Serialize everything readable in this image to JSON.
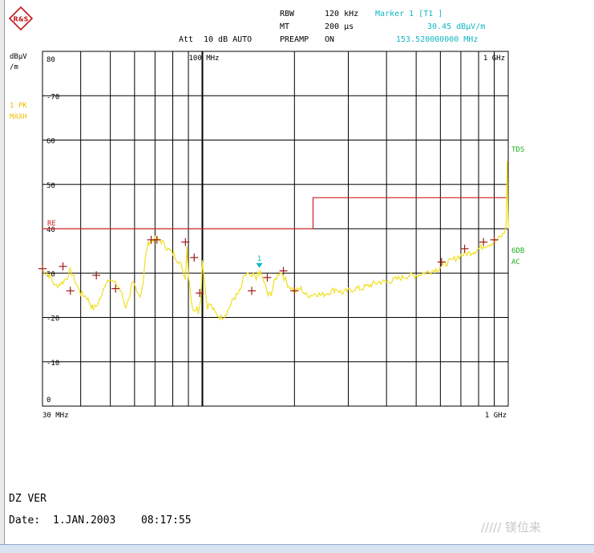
{
  "header": {
    "rbw_label": "RBW",
    "rbw_value": "120 kHz",
    "mt_label": "MT",
    "mt_value": "200 µs",
    "att_label": "Att",
    "att_value": "10 dB AUTO",
    "preamp_label": "PREAMP",
    "preamp_value": "ON",
    "marker_label": "Marker 1 [T1 ]",
    "marker_level": "30.45 dBµV/m",
    "marker_freq": "153.520000000 MHz"
  },
  "logo": {
    "text": "R&S",
    "icon": "rohde-schwarz-logo-icon"
  },
  "footer": {
    "title": "DZ VER",
    "date_label": "Date:",
    "date_value": "1.JAN.2003",
    "time_value": "08:17:55"
  },
  "watermark": "///// 镁位来",
  "colors": {
    "trace": "#f0e020",
    "limit": "#d02020",
    "marker": "#a01818",
    "marker_current": "#13b6c2",
    "side_label_green": "#20b020",
    "side_label_yellow": "#f0c000",
    "grid": "#000000"
  },
  "chart_data": {
    "type": "line",
    "x_scale": "log",
    "xlim_mhz": [
      30,
      1000
    ],
    "ylim": [
      0,
      80
    ],
    "ylabel": "dBµV\n/m",
    "grid": true,
    "y_ticks": [
      0,
      10,
      20,
      30,
      40,
      50,
      60,
      70,
      80
    ],
    "y_tick_labels": [
      "0",
      "-10",
      "-20",
      "30",
      "40",
      "50",
      "60",
      "-70",
      "80"
    ],
    "x_tick_labels_top": [
      {
        "mhz": 100,
        "label": "100 MHz"
      },
      {
        "mhz": 1000,
        "label": "1 GHz"
      }
    ],
    "x_tick_labels_bottom": [
      {
        "mhz": 30,
        "label": "30 MHz"
      },
      {
        "mhz": 1000,
        "label": "1 GHz"
      }
    ],
    "side_labels_left": [
      {
        "text": "1 PK",
        "color": "yellow"
      },
      {
        "text": "MAXH",
        "color": "yellow"
      }
    ],
    "side_labels_right": [
      {
        "text": "TDS",
        "color": "green"
      },
      {
        "text": "6DB",
        "color": "green"
      },
      {
        "text": "AC",
        "color": "green"
      }
    ],
    "limit_line": {
      "name": "RE",
      "points_mhz_db": [
        [
          30,
          40
        ],
        [
          230,
          40
        ],
        [
          230,
          47
        ],
        [
          1000,
          47
        ]
      ]
    },
    "series": [
      {
        "points_mhz_db": [
          [
            30,
            30.5
          ],
          [
            31,
            30
          ],
          [
            32,
            29
          ],
          [
            33,
            27
          ],
          [
            34,
            27.5
          ],
          [
            35,
            28
          ],
          [
            36,
            29
          ],
          [
            37,
            30.5
          ],
          [
            38,
            29
          ],
          [
            39,
            27
          ],
          [
            40,
            25.5
          ],
          [
            41,
            25
          ],
          [
            42,
            24.5
          ],
          [
            43,
            23
          ],
          [
            44,
            22
          ],
          [
            45,
            22.5
          ],
          [
            46,
            24
          ],
          [
            47,
            25
          ],
          [
            48,
            27.5
          ],
          [
            49,
            28.5
          ],
          [
            50,
            29
          ],
          [
            51,
            28
          ],
          [
            52,
            27.5
          ],
          [
            53,
            27
          ],
          [
            54,
            26
          ],
          [
            55,
            24.5
          ],
          [
            56,
            22.5
          ],
          [
            57,
            23.5
          ],
          [
            58,
            25.5
          ],
          [
            59,
            27.5
          ],
          [
            60,
            27
          ],
          [
            61,
            25.5
          ],
          [
            62,
            25
          ],
          [
            63,
            25.5
          ],
          [
            64,
            28
          ],
          [
            65,
            33
          ],
          [
            66,
            36
          ],
          [
            67,
            37
          ],
          [
            68,
            37.5
          ],
          [
            70,
            37.5
          ],
          [
            72,
            37.5
          ],
          [
            74,
            37
          ],
          [
            76,
            36
          ],
          [
            78,
            35
          ],
          [
            80,
            34.5
          ],
          [
            82,
            33.5
          ],
          [
            84,
            32.5
          ],
          [
            86,
            31
          ],
          [
            88,
            29
          ],
          [
            89,
            36
          ],
          [
            90,
            30
          ],
          [
            91,
            27
          ],
          [
            92,
            24
          ],
          [
            93,
            22
          ],
          [
            94,
            21
          ],
          [
            95,
            22
          ],
          [
            96,
            23
          ],
          [
            97,
            21.5
          ],
          [
            98,
            22.5
          ],
          [
            99,
            25
          ],
          [
            100,
            33
          ],
          [
            101,
            30
          ],
          [
            102,
            27
          ],
          [
            103,
            24
          ],
          [
            104,
            22.5
          ],
          [
            106,
            23
          ],
          [
            108,
            22
          ],
          [
            110,
            21
          ],
          [
            112,
            20.5
          ],
          [
            115,
            20
          ],
          [
            118,
            20.5
          ],
          [
            121,
            21.5
          ],
          [
            124,
            23
          ],
          [
            127,
            24.5
          ],
          [
            130,
            25
          ],
          [
            133,
            26
          ],
          [
            136,
            28.5
          ],
          [
            140,
            30
          ],
          [
            144,
            29
          ],
          [
            148,
            29.5
          ],
          [
            150,
            28
          ],
          [
            152,
            30.45
          ],
          [
            156,
            29.5
          ],
          [
            160,
            27.5
          ],
          [
            164,
            25
          ],
          [
            168,
            25.5
          ],
          [
            172,
            28
          ],
          [
            176,
            29.5
          ],
          [
            180,
            30.5
          ],
          [
            185,
            29
          ],
          [
            190,
            27.5
          ],
          [
            196,
            26.5
          ],
          [
            202,
            26
          ],
          [
            210,
            26.5
          ],
          [
            218,
            25
          ],
          [
            226,
            25
          ],
          [
            234,
            25.5
          ],
          [
            245,
            25
          ],
          [
            255,
            25.5
          ],
          [
            265,
            26
          ],
          [
            275,
            26.5
          ],
          [
            285,
            25.5
          ],
          [
            300,
            26
          ],
          [
            315,
            26.5
          ],
          [
            330,
            26.5
          ],
          [
            345,
            27
          ],
          [
            360,
            27.5
          ],
          [
            380,
            28
          ],
          [
            400,
            28
          ],
          [
            425,
            28.5
          ],
          [
            450,
            29
          ],
          [
            475,
            29.5
          ],
          [
            500,
            29.5
          ],
          [
            530,
            30
          ],
          [
            560,
            30.5
          ],
          [
            590,
            31
          ],
          [
            620,
            32
          ],
          [
            660,
            33
          ],
          [
            700,
            34
          ],
          [
            740,
            34.5
          ],
          [
            780,
            35
          ],
          [
            820,
            36
          ],
          [
            860,
            36.5
          ],
          [
            900,
            37
          ],
          [
            940,
            38
          ],
          [
            970,
            39
          ],
          [
            985,
            41
          ],
          [
            990,
            50
          ],
          [
            993,
            55
          ],
          [
            996,
            47
          ],
          [
            1000,
            40
          ]
        ]
      }
    ],
    "markers_mhz_db": [
      [
        30,
        31
      ],
      [
        35,
        31.5
      ],
      [
        37,
        26
      ],
      [
        45,
        29.5
      ],
      [
        52,
        26.5
      ],
      [
        68,
        37.5
      ],
      [
        71,
        37.5
      ],
      [
        88,
        37
      ],
      [
        94,
        33.5
      ],
      [
        98,
        25.5
      ],
      [
        145,
        26
      ],
      [
        163,
        29
      ],
      [
        184,
        30.5
      ],
      [
        200,
        26
      ],
      [
        605,
        32.5
      ],
      [
        720,
        35.5
      ],
      [
        830,
        37
      ],
      [
        900,
        37.5
      ]
    ],
    "current_marker": {
      "label": "1",
      "mhz": 153.52,
      "db": 30.45
    }
  }
}
